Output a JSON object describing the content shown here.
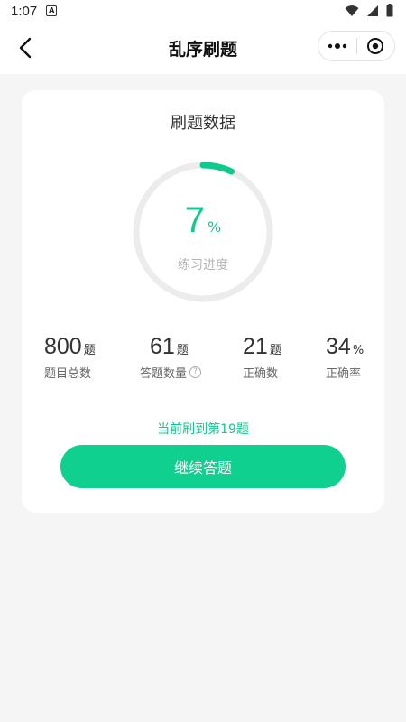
{
  "status_bar": {
    "time": "1:07",
    "notification_letter": "A"
  },
  "nav": {
    "title": "乱序刷题"
  },
  "card": {
    "title": "刷题数据",
    "progress": {
      "value": "7",
      "unit": "%",
      "fraction": 0.07,
      "label": "练习进度"
    },
    "stats": [
      {
        "value": "800",
        "unit": "题",
        "label": "题目总数"
      },
      {
        "value": "61",
        "unit": "题",
        "label": "答题数量",
        "help": "?"
      },
      {
        "value": "21",
        "unit": "题",
        "label": "正确数"
      },
      {
        "value": "34",
        "unit": "%",
        "label": "正确率"
      }
    ],
    "current": "当前刷到第19题",
    "continue_label": "继续答题"
  },
  "colors": {
    "accent": "#10c98d",
    "button": "#10d08f",
    "ring_track": "#ececec"
  }
}
